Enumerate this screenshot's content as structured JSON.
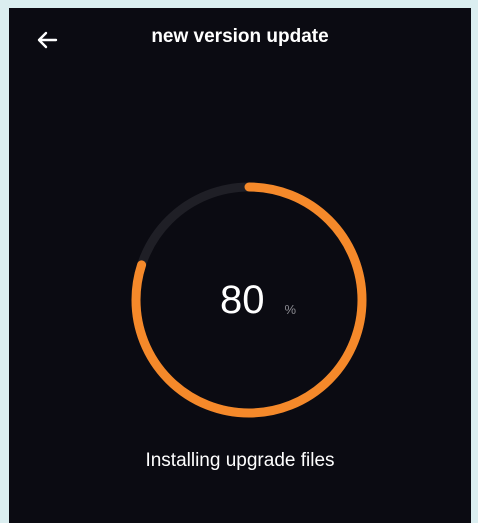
{
  "header": {
    "back_icon": "arrow-left-icon",
    "title": "new version update"
  },
  "progress": {
    "value": "80",
    "unit": "%",
    "fraction": 0.8,
    "track_color": "#1f1f26",
    "fill_color": "#f5892a"
  },
  "status": {
    "text": "Installing upgrade files"
  },
  "colors": {
    "screen_background": "#0b0b12",
    "outer_background": "#dbeef0",
    "text": "#ffffff"
  }
}
